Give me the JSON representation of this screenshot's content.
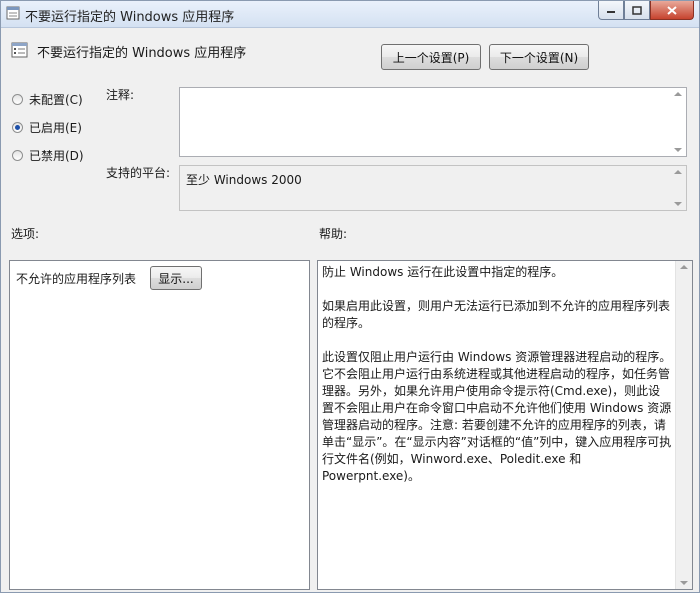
{
  "window": {
    "title": "不要运行指定的 Windows 应用程序"
  },
  "header": {
    "policy_title": "不要运行指定的 Windows 应用程序",
    "prev_label": "上一个设置(P)",
    "next_label": "下一个设置(N)"
  },
  "state": {
    "options": [
      {
        "label": "未配置(C)",
        "selected": false
      },
      {
        "label": "已启用(E)",
        "selected": true
      },
      {
        "label": "已禁用(D)",
        "selected": false
      }
    ]
  },
  "comment": {
    "label": "注释:",
    "value": ""
  },
  "platform": {
    "label": "支持的平台:",
    "value": "至少 Windows 2000"
  },
  "options_section": {
    "label": "选项:",
    "list_label": "不允许的应用程序列表",
    "show_label": "显示..."
  },
  "help_section": {
    "label": "帮助:",
    "paragraphs": [
      "防止 Windows 运行在此设置中指定的程序。",
      "如果启用此设置，则用户无法运行已添加到不允许的应用程序列表的程序。",
      "此设置仅阻止用户运行由 Windows 资源管理器进程启动的程序。它不会阻止用户运行由系统进程或其他进程启动的程序，如任务管理器。另外，如果允许用户使用命令提示符(Cmd.exe)，则此设置不会阻止用户在命令窗口中启动不允许他们使用 Windows 资源管理器启动的程序。注意: 若要创建不允许的应用程序的列表，请单击“显示”。在“显示内容”对话框的“值”列中，键入应用程序可执行文件名(例如，Winword.exe、Poledit.exe 和 Powerpnt.exe)。"
    ]
  },
  "icons": {
    "window": "policy-window-icon",
    "policy": "policy-setting-icon",
    "minimize": "minimize-icon",
    "maximize": "maximize-icon",
    "close": "close-icon"
  },
  "colors": {
    "accent_radio": "#1c4fa8",
    "close_button": "#c6432e"
  }
}
